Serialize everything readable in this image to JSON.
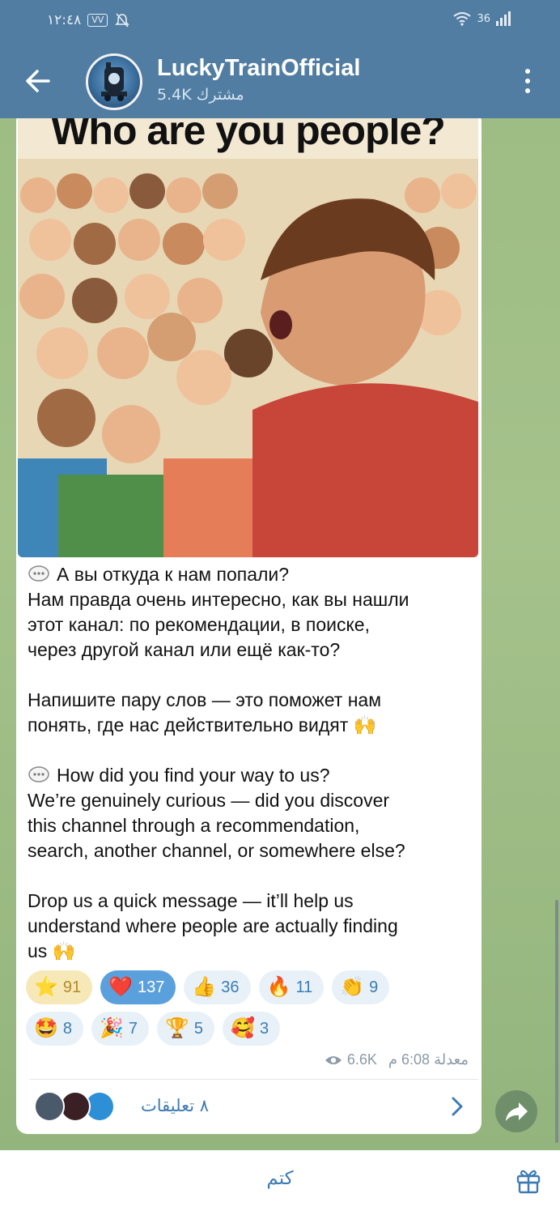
{
  "status_bar": {
    "time": "١٢:٤٨",
    "volte_badge": "VV",
    "network": "36"
  },
  "header": {
    "title": "LuckyTrainOfficial",
    "subscribers": "5.4K مشترك"
  },
  "post": {
    "image_caption": "Who are you people?",
    "paragraphs": [
      {
        "lines": [
          "А вы откуда к нам попали?",
          "Нам правда очень интересно, как вы нашли",
          "этот канал: по рекомендации, в поиске,",
          "через другой канал или ещё как-то?"
        ]
      },
      {
        "lines": [
          "Напишите пару слов — это поможет нам",
          "понять, где нас действительно видят 🙌"
        ]
      },
      {
        "lines": [
          "How did you find your way to us?",
          "We’re genuinely curious — did you discover",
          "this channel through a recommendation,",
          "search, another channel, or somewhere else?"
        ]
      },
      {
        "lines": [
          "Drop us a quick message — it’ll help us",
          "understand where people are actually finding",
          "us 🙌"
        ]
      }
    ],
    "reactions_row1": [
      {
        "emoji": "⭐",
        "count": "91"
      },
      {
        "emoji": "❤️",
        "count": "137"
      },
      {
        "emoji": "👍",
        "count": "36"
      },
      {
        "emoji": "🔥",
        "count": "11"
      },
      {
        "emoji": "👏",
        "count": "9"
      }
    ],
    "reactions_row2": [
      {
        "emoji": "🤩",
        "count": "8"
      },
      {
        "emoji": "🎉",
        "count": "7"
      },
      {
        "emoji": "🏆",
        "count": "5"
      },
      {
        "emoji": "🥰",
        "count": "3"
      }
    ],
    "views": "6.6K",
    "edited_time": "معدلة 6:08 م",
    "comments_label": "٨ تعليقات"
  },
  "bottom_bar": {
    "mute_label": "كتم"
  },
  "colors": {
    "header_bg": "#517da2",
    "accent": "#3c7bb3",
    "chat_bg": "#9dbd84"
  }
}
